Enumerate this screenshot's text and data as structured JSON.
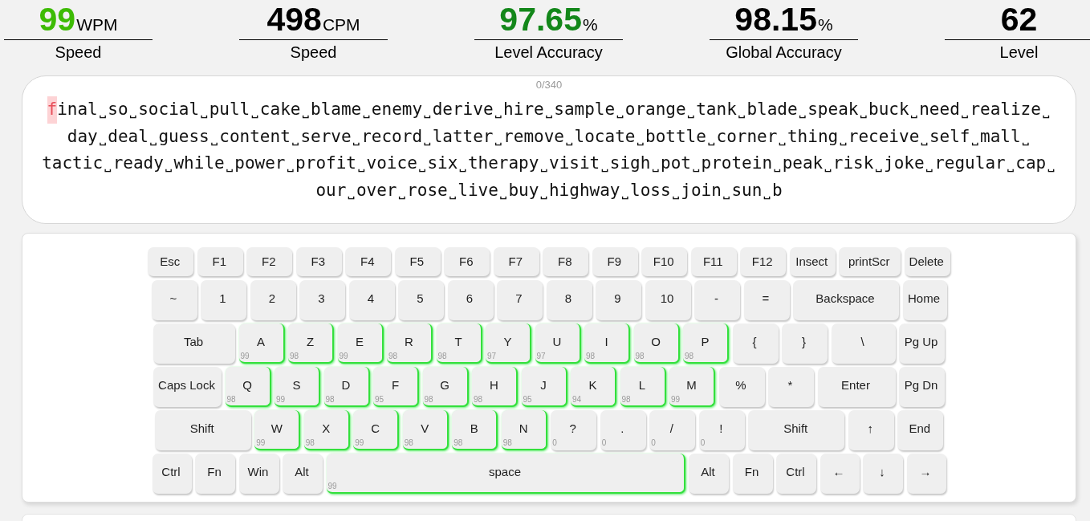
{
  "stats": [
    {
      "value": "99",
      "unit": "WPM",
      "label": "Speed",
      "color": "#3dbb04"
    },
    {
      "value": "498",
      "unit": "CPM",
      "label": "Speed",
      "color": "#000000"
    },
    {
      "value": "97.65",
      "unit": "%",
      "label": "Level Accuracy",
      "color": "#13871a"
    },
    {
      "value": "98.15",
      "unit": "%",
      "label": "Global Accuracy",
      "color": "#000000"
    },
    {
      "value": "62",
      "label": "Level",
      "color": "#000000"
    }
  ],
  "typing_panel": {
    "counter": "0/340",
    "lines": [
      [
        {
          "text": "f",
          "current": true
        },
        {
          "text": "inal˽so˽social˽pull˽cake˽blame˽enemy˽derive˽hire˽sample˽orange˽tank˽blade˽speak˽buck˽need˽realize˽",
          "current": false
        }
      ],
      [
        {
          "text": "day˽deal˽guess˽content˽serve˽record˽latter˽remove˽locate˽bottle˽corner˽thing˽receive˽self˽mall˽",
          "current": false
        }
      ],
      [
        {
          "text": "tactic˽ready˽while˽power˽profit˽voice˽six˽therapy˽visit˽sigh˽pot˽protein˽peak˽risk˽joke˽regular˽cap˽",
          "current": false
        }
      ],
      [
        {
          "text": "our˽over˽rose˽live˽buy˽highway˽loss˽join˽sun˽b",
          "current": false
        }
      ]
    ]
  },
  "keyboard": {
    "rows": [
      {
        "keys": [
          {
            "label": "Esc",
            "highlighted": false
          },
          {
            "label": "F1",
            "highlighted": false
          },
          {
            "label": "F2",
            "highlighted": false
          },
          {
            "label": "F3",
            "highlighted": false
          },
          {
            "label": "F4",
            "highlighted": false
          },
          {
            "label": "F5",
            "highlighted": false
          },
          {
            "label": "F6",
            "highlighted": false
          },
          {
            "label": "F7",
            "highlighted": false
          },
          {
            "label": "F8",
            "highlighted": false
          },
          {
            "label": "F9",
            "highlighted": false
          },
          {
            "label": "F10",
            "highlighted": false
          },
          {
            "label": "F11",
            "highlighted": false
          },
          {
            "label": "F12",
            "highlighted": false
          },
          {
            "label": "Insect",
            "highlighted": false
          },
          {
            "label": "printScr",
            "highlighted": false
          },
          {
            "label": "Delete",
            "highlighted": false
          }
        ]
      },
      {
        "keys": [
          {
            "label": "~",
            "highlighted": false
          },
          {
            "label": "1",
            "highlighted": false
          },
          {
            "label": "2",
            "highlighted": false
          },
          {
            "label": "3",
            "highlighted": false
          },
          {
            "label": "4",
            "highlighted": false
          },
          {
            "label": "5",
            "highlighted": false
          },
          {
            "label": "6",
            "highlighted": false
          },
          {
            "label": "7",
            "highlighted": false
          },
          {
            "label": "8",
            "highlighted": false
          },
          {
            "label": "9",
            "highlighted": false
          },
          {
            "label": "10",
            "highlighted": false
          },
          {
            "label": "-",
            "highlighted": false
          },
          {
            "label": "=",
            "highlighted": false
          },
          {
            "label": "Backspace",
            "highlighted": false
          },
          {
            "label": "Home",
            "highlighted": false
          }
        ]
      },
      {
        "keys": [
          {
            "label": "Tab",
            "highlighted": false
          },
          {
            "label": "A",
            "score": "99",
            "highlighted": true
          },
          {
            "label": "Z",
            "score": "98",
            "highlighted": true
          },
          {
            "label": "E",
            "score": "99",
            "highlighted": true
          },
          {
            "label": "R",
            "score": "98",
            "highlighted": true
          },
          {
            "label": "T",
            "score": "98",
            "highlighted": true
          },
          {
            "label": "Y",
            "score": "97",
            "highlighted": true
          },
          {
            "label": "U",
            "score": "97",
            "highlighted": true
          },
          {
            "label": "I",
            "score": "98",
            "highlighted": true
          },
          {
            "label": "O",
            "score": "98",
            "highlighted": true
          },
          {
            "label": "P",
            "score": "98",
            "highlighted": true
          },
          {
            "label": "{",
            "highlighted": false
          },
          {
            "label": "}",
            "highlighted": false
          },
          {
            "label": "\\",
            "highlighted": false
          },
          {
            "label": "Pg Up",
            "highlighted": false
          }
        ]
      },
      {
        "keys": [
          {
            "label": "Caps Lock",
            "highlighted": false
          },
          {
            "label": "Q",
            "score": "98",
            "highlighted": true
          },
          {
            "label": "S",
            "score": "99",
            "highlighted": true
          },
          {
            "label": "D",
            "score": "98",
            "highlighted": true
          },
          {
            "label": "F",
            "score": "95",
            "highlighted": true
          },
          {
            "label": "G",
            "score": "98",
            "highlighted": true
          },
          {
            "label": "H",
            "score": "98",
            "highlighted": true
          },
          {
            "label": "J",
            "score": "95",
            "highlighted": true
          },
          {
            "label": "K",
            "score": "94",
            "highlighted": true
          },
          {
            "label": "L",
            "score": "98",
            "highlighted": true
          },
          {
            "label": "M",
            "score": "99",
            "highlighted": true
          },
          {
            "label": "%",
            "highlighted": false
          },
          {
            "label": "*",
            "highlighted": false
          },
          {
            "label": "Enter",
            "highlighted": false
          },
          {
            "label": "Pg Dn",
            "highlighted": false
          }
        ]
      },
      {
        "keys": [
          {
            "label": "Shift",
            "highlighted": false
          },
          {
            "label": "W",
            "score": "99",
            "highlighted": true
          },
          {
            "label": "X",
            "score": "98",
            "highlighted": true
          },
          {
            "label": "C",
            "score": "99",
            "highlighted": true
          },
          {
            "label": "V",
            "score": "98",
            "highlighted": true
          },
          {
            "label": "B",
            "score": "98",
            "highlighted": true
          },
          {
            "label": "N",
            "score": "98",
            "highlighted": true
          },
          {
            "label": "?",
            "score": "0",
            "highlighted": false
          },
          {
            "label": ".",
            "score": "0",
            "highlighted": false
          },
          {
            "label": "/",
            "score": "0",
            "highlighted": false
          },
          {
            "label": "!",
            "score": "0",
            "highlighted": false
          },
          {
            "label": "Shift",
            "highlighted": false
          },
          {
            "label": "↑",
            "highlighted": false
          },
          {
            "label": "End",
            "highlighted": false
          }
        ]
      },
      {
        "keys": [
          {
            "label": "Ctrl",
            "highlighted": false
          },
          {
            "label": "Fn",
            "highlighted": false
          },
          {
            "label": "Win",
            "highlighted": false
          },
          {
            "label": "Alt",
            "highlighted": false
          },
          {
            "label": "space",
            "score": "99",
            "highlighted": true
          },
          {
            "label": "Alt",
            "highlighted": false
          },
          {
            "label": "Fn",
            "highlighted": false
          },
          {
            "label": "Ctrl",
            "highlighted": false
          },
          {
            "label": "←",
            "highlighted": false
          },
          {
            "label": "↓",
            "highlighted": false
          },
          {
            "label": "→",
            "highlighted": false
          }
        ]
      }
    ]
  }
}
